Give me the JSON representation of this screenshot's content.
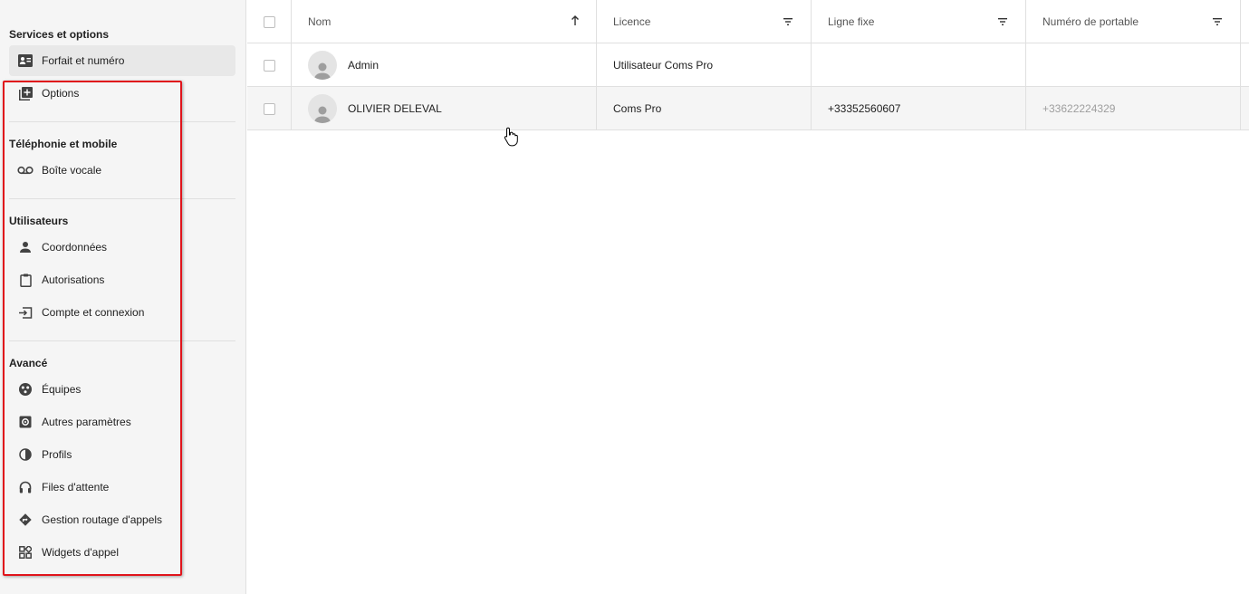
{
  "sidebar": {
    "sections": [
      {
        "title": "Services et options",
        "items": [
          {
            "label": "Forfait et numéro",
            "icon": "contact-card-icon"
          },
          {
            "label": "Options",
            "icon": "library-add-icon"
          }
        ]
      },
      {
        "title": "Téléphonie et mobile",
        "items": [
          {
            "label": "Boîte vocale",
            "icon": "voicemail-icon"
          }
        ]
      },
      {
        "title": "Utilisateurs",
        "items": [
          {
            "label": "Coordonnées",
            "icon": "person-icon"
          },
          {
            "label": "Autorisations",
            "icon": "clipboard-icon"
          },
          {
            "label": "Compte et connexion",
            "icon": "login-icon"
          }
        ]
      },
      {
        "title": "Avancé",
        "items": [
          {
            "label": "Équipes",
            "icon": "groups-icon"
          },
          {
            "label": "Autres paramètres",
            "icon": "settings-box-icon"
          },
          {
            "label": "Profils",
            "icon": "contrast-icon"
          },
          {
            "label": "Files d'attente",
            "icon": "headset-icon"
          },
          {
            "label": "Gestion routage d'appels",
            "icon": "directions-icon"
          },
          {
            "label": "Widgets d'appel",
            "icon": "widgets-icon"
          }
        ]
      }
    ],
    "active_item": "Forfait et numéro",
    "highlight_color": "#e0141b"
  },
  "table": {
    "columns": [
      {
        "label": "Nom",
        "icon": "sort-arrow-up-icon"
      },
      {
        "label": "Licence",
        "icon": "filter-icon"
      },
      {
        "label": "Ligne fixe",
        "icon": "filter-icon"
      },
      {
        "label": "Numéro de portable",
        "icon": "filter-icon"
      }
    ],
    "rows": [
      {
        "nom": "Admin",
        "licence": "Utilisateur Coms Pro",
        "ligne_fixe": "",
        "portable": ""
      },
      {
        "nom": "OLIVIER DELEVAL",
        "licence": "Coms Pro",
        "ligne_fixe": "+33352560607",
        "portable": "+33622224329"
      }
    ]
  }
}
